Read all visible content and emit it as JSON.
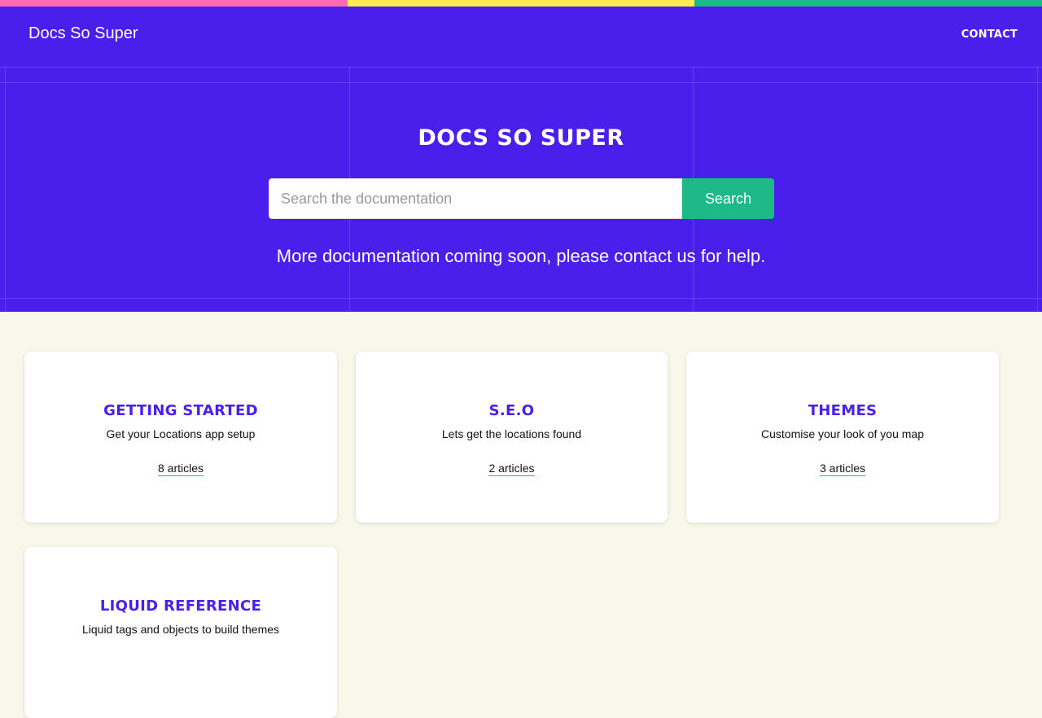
{
  "colors": {
    "stripe": [
      "#ff6ab0",
      "#ffed4f",
      "#1dba87"
    ],
    "header_bg": "#4a1fec",
    "accent": "#1dba87",
    "page_bg": "#f7f7ea"
  },
  "nav": {
    "brand": "Docs So Super",
    "contact": "CONTACT"
  },
  "hero": {
    "title": "DOCS SO SUPER",
    "search_placeholder": "Search the documentation",
    "search_value": "",
    "search_button": "Search",
    "notice": "More documentation coming soon, please contact us for help."
  },
  "categories": [
    {
      "title": "GETTING STARTED",
      "description": "Get your Locations app setup",
      "articles": "8 articles"
    },
    {
      "title": "S.E.O",
      "description": "Lets get the locations found",
      "articles": "2 articles"
    },
    {
      "title": "THEMES",
      "description": "Customise your look of you map",
      "articles": "3 articles"
    },
    {
      "title": "LIQUID REFERENCE",
      "description": "Liquid tags and objects to build themes",
      "articles": ""
    }
  ]
}
